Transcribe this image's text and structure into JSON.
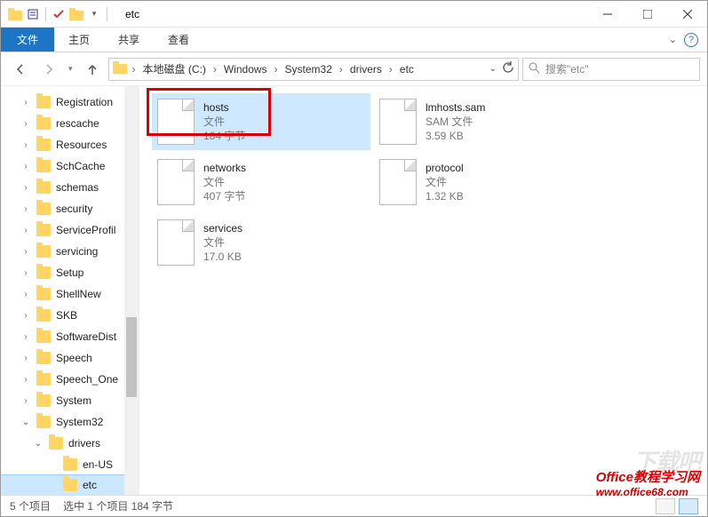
{
  "window": {
    "title": "etc"
  },
  "ribbon": {
    "file": "文件",
    "tabs": [
      "主页",
      "共享",
      "查看"
    ]
  },
  "address": {
    "segments": [
      "本地磁盘 (C:)",
      "Windows",
      "System32",
      "drivers",
      "etc"
    ]
  },
  "search": {
    "placeholder": "搜索\"etc\""
  },
  "sidebar": {
    "items": [
      {
        "label": "Registration",
        "indent": 0
      },
      {
        "label": "rescache",
        "indent": 0
      },
      {
        "label": "Resources",
        "indent": 0
      },
      {
        "label": "SchCache",
        "indent": 0
      },
      {
        "label": "schemas",
        "indent": 0
      },
      {
        "label": "security",
        "indent": 0
      },
      {
        "label": "ServiceProfil",
        "indent": 0
      },
      {
        "label": "servicing",
        "indent": 0
      },
      {
        "label": "Setup",
        "indent": 0
      },
      {
        "label": "ShellNew",
        "indent": 0
      },
      {
        "label": "SKB",
        "indent": 0
      },
      {
        "label": "SoftwareDist",
        "indent": 0
      },
      {
        "label": "Speech",
        "indent": 0
      },
      {
        "label": "Speech_One",
        "indent": 0
      },
      {
        "label": "System",
        "indent": 0
      },
      {
        "label": "System32",
        "indent": 0,
        "expanded": true
      },
      {
        "label": "drivers",
        "indent": 1,
        "expanded": true
      },
      {
        "label": "en-US",
        "indent": 2
      },
      {
        "label": "etc",
        "indent": 2,
        "selected": true
      }
    ]
  },
  "files": [
    {
      "name": "hosts",
      "type": "文件",
      "size": "184 字节",
      "selected": true,
      "highlight": true
    },
    {
      "name": "lmhosts.sam",
      "type": "SAM 文件",
      "size": "3.59 KB"
    },
    {
      "name": "networks",
      "type": "文件",
      "size": "407 字节"
    },
    {
      "name": "protocol",
      "type": "文件",
      "size": "1.32 KB"
    },
    {
      "name": "services",
      "type": "文件",
      "size": "17.0 KB"
    }
  ],
  "status": {
    "count": "5 个项目",
    "selection": "选中 1 个项目 184 字节"
  },
  "watermark1": "下载吧",
  "watermark2_line1": "Office教程学习网",
  "watermark2_line2": "www.office68.com"
}
